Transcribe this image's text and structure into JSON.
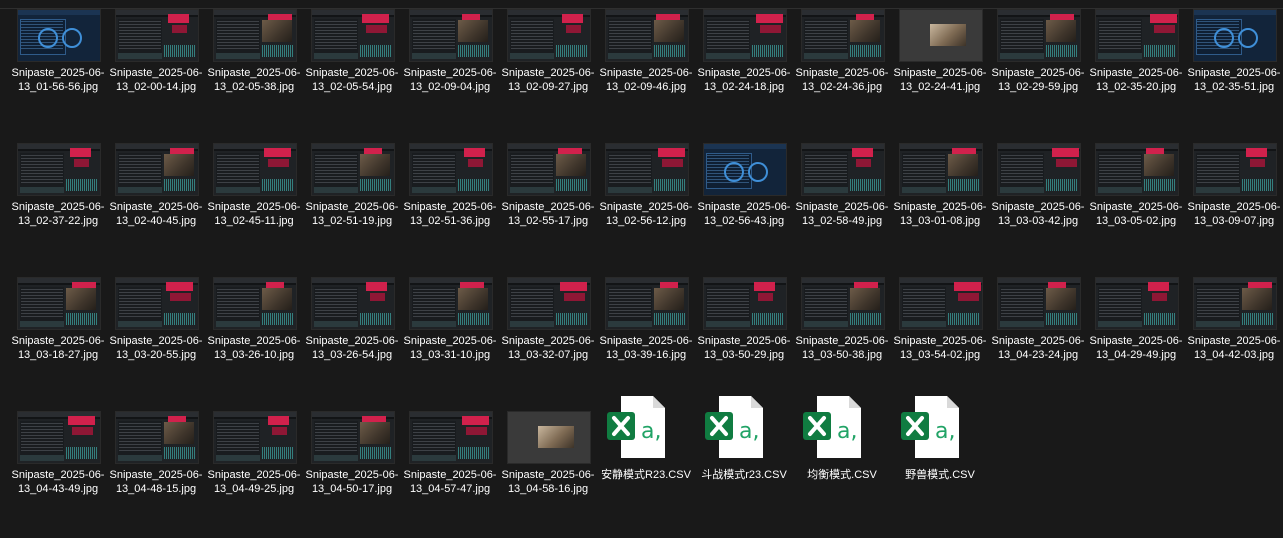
{
  "files": [
    {
      "name": "Snipaste_2025-06-13_01-56-56.jpg",
      "kind": "image",
      "variant": "blue"
    },
    {
      "name": "Snipaste_2025-06-13_02-00-14.jpg",
      "kind": "image",
      "variant": "dark"
    },
    {
      "name": "Snipaste_2025-06-13_02-05-38.jpg",
      "kind": "image",
      "variant": "dark"
    },
    {
      "name": "Snipaste_2025-06-13_02-05-54.jpg",
      "kind": "image",
      "variant": "dark"
    },
    {
      "name": "Snipaste_2025-06-13_02-09-04.jpg",
      "kind": "image",
      "variant": "dark"
    },
    {
      "name": "Snipaste_2025-06-13_02-09-27.jpg",
      "kind": "image",
      "variant": "dark"
    },
    {
      "name": "Snipaste_2025-06-13_02-09-46.jpg",
      "kind": "image",
      "variant": "dark"
    },
    {
      "name": "Snipaste_2025-06-13_02-24-18.jpg",
      "kind": "image",
      "variant": "dark"
    },
    {
      "name": "Snipaste_2025-06-13_02-24-36.jpg",
      "kind": "image",
      "variant": "dark"
    },
    {
      "name": "Snipaste_2025-06-13_02-24-41.jpg",
      "kind": "image",
      "variant": "grey"
    },
    {
      "name": "Snipaste_2025-06-13_02-29-59.jpg",
      "kind": "image",
      "variant": "dark"
    },
    {
      "name": "Snipaste_2025-06-13_02-35-20.jpg",
      "kind": "image",
      "variant": "dark"
    },
    {
      "name": "Snipaste_2025-06-13_02-35-51.jpg",
      "kind": "image",
      "variant": "blue"
    },
    {
      "name": "Snipaste_2025-06-13_02-37-22.jpg",
      "kind": "image",
      "variant": "dark"
    },
    {
      "name": "Snipaste_2025-06-13_02-40-45.jpg",
      "kind": "image",
      "variant": "dark"
    },
    {
      "name": "Snipaste_2025-06-13_02-45-11.jpg",
      "kind": "image",
      "variant": "dark"
    },
    {
      "name": "Snipaste_2025-06-13_02-51-19.jpg",
      "kind": "image",
      "variant": "dark"
    },
    {
      "name": "Snipaste_2025-06-13_02-51-36.jpg",
      "kind": "image",
      "variant": "dark"
    },
    {
      "name": "Snipaste_2025-06-13_02-55-17.jpg",
      "kind": "image",
      "variant": "dark"
    },
    {
      "name": "Snipaste_2025-06-13_02-56-12.jpg",
      "kind": "image",
      "variant": "dark"
    },
    {
      "name": "Snipaste_2025-06-13_02-56-43.jpg",
      "kind": "image",
      "variant": "blue"
    },
    {
      "name": "Snipaste_2025-06-13_02-58-49.jpg",
      "kind": "image",
      "variant": "dark"
    },
    {
      "name": "Snipaste_2025-06-13_03-01-08.jpg",
      "kind": "image",
      "variant": "dark"
    },
    {
      "name": "Snipaste_2025-06-13_03-03-42.jpg",
      "kind": "image",
      "variant": "dark"
    },
    {
      "name": "Snipaste_2025-06-13_03-05-02.jpg",
      "kind": "image",
      "variant": "dark"
    },
    {
      "name": "Snipaste_2025-06-13_03-09-07.jpg",
      "kind": "image",
      "variant": "dark"
    },
    {
      "name": "Snipaste_2025-06-13_03-18-27.jpg",
      "kind": "image",
      "variant": "dark"
    },
    {
      "name": "Snipaste_2025-06-13_03-20-55.jpg",
      "kind": "image",
      "variant": "dark"
    },
    {
      "name": "Snipaste_2025-06-13_03-26-10.jpg",
      "kind": "image",
      "variant": "dark"
    },
    {
      "name": "Snipaste_2025-06-13_03-26-54.jpg",
      "kind": "image",
      "variant": "dark"
    },
    {
      "name": "Snipaste_2025-06-13_03-31-10.jpg",
      "kind": "image",
      "variant": "dark"
    },
    {
      "name": "Snipaste_2025-06-13_03-32-07.jpg",
      "kind": "image",
      "variant": "dark"
    },
    {
      "name": "Snipaste_2025-06-13_03-39-16.jpg",
      "kind": "image",
      "variant": "dark"
    },
    {
      "name": "Snipaste_2025-06-13_03-50-29.jpg",
      "kind": "image",
      "variant": "dark"
    },
    {
      "name": "Snipaste_2025-06-13_03-50-38.jpg",
      "kind": "image",
      "variant": "dark"
    },
    {
      "name": "Snipaste_2025-06-13_03-54-02.jpg",
      "kind": "image",
      "variant": "dark"
    },
    {
      "name": "Snipaste_2025-06-13_04-23-24.jpg",
      "kind": "image",
      "variant": "dark"
    },
    {
      "name": "Snipaste_2025-06-13_04-29-49.jpg",
      "kind": "image",
      "variant": "dark"
    },
    {
      "name": "Snipaste_2025-06-13_04-42-03.jpg",
      "kind": "image",
      "variant": "dark"
    },
    {
      "name": "Snipaste_2025-06-13_04-43-49.jpg",
      "kind": "image",
      "variant": "dark"
    },
    {
      "name": "Snipaste_2025-06-13_04-48-15.jpg",
      "kind": "image",
      "variant": "dark"
    },
    {
      "name": "Snipaste_2025-06-13_04-49-25.jpg",
      "kind": "image",
      "variant": "dark"
    },
    {
      "name": "Snipaste_2025-06-13_04-50-17.jpg",
      "kind": "image",
      "variant": "dark"
    },
    {
      "name": "Snipaste_2025-06-13_04-57-47.jpg",
      "kind": "image",
      "variant": "dark"
    },
    {
      "name": "Snipaste_2025-06-13_04-58-16.jpg",
      "kind": "image",
      "variant": "grey"
    },
    {
      "name": "安静模式R23.CSV",
      "kind": "csv"
    },
    {
      "name": "斗战模式r23.CSV",
      "kind": "csv"
    },
    {
      "name": "均衡模式.CSV",
      "kind": "csv"
    },
    {
      "name": "野兽模式.CSV",
      "kind": "csv"
    }
  ],
  "colors": {
    "background": "#191919",
    "excel_green": "#107c41",
    "excel_letter": "#21a366"
  },
  "icons": {
    "csv": "excel-csv-icon",
    "image": "image-thumbnail"
  }
}
